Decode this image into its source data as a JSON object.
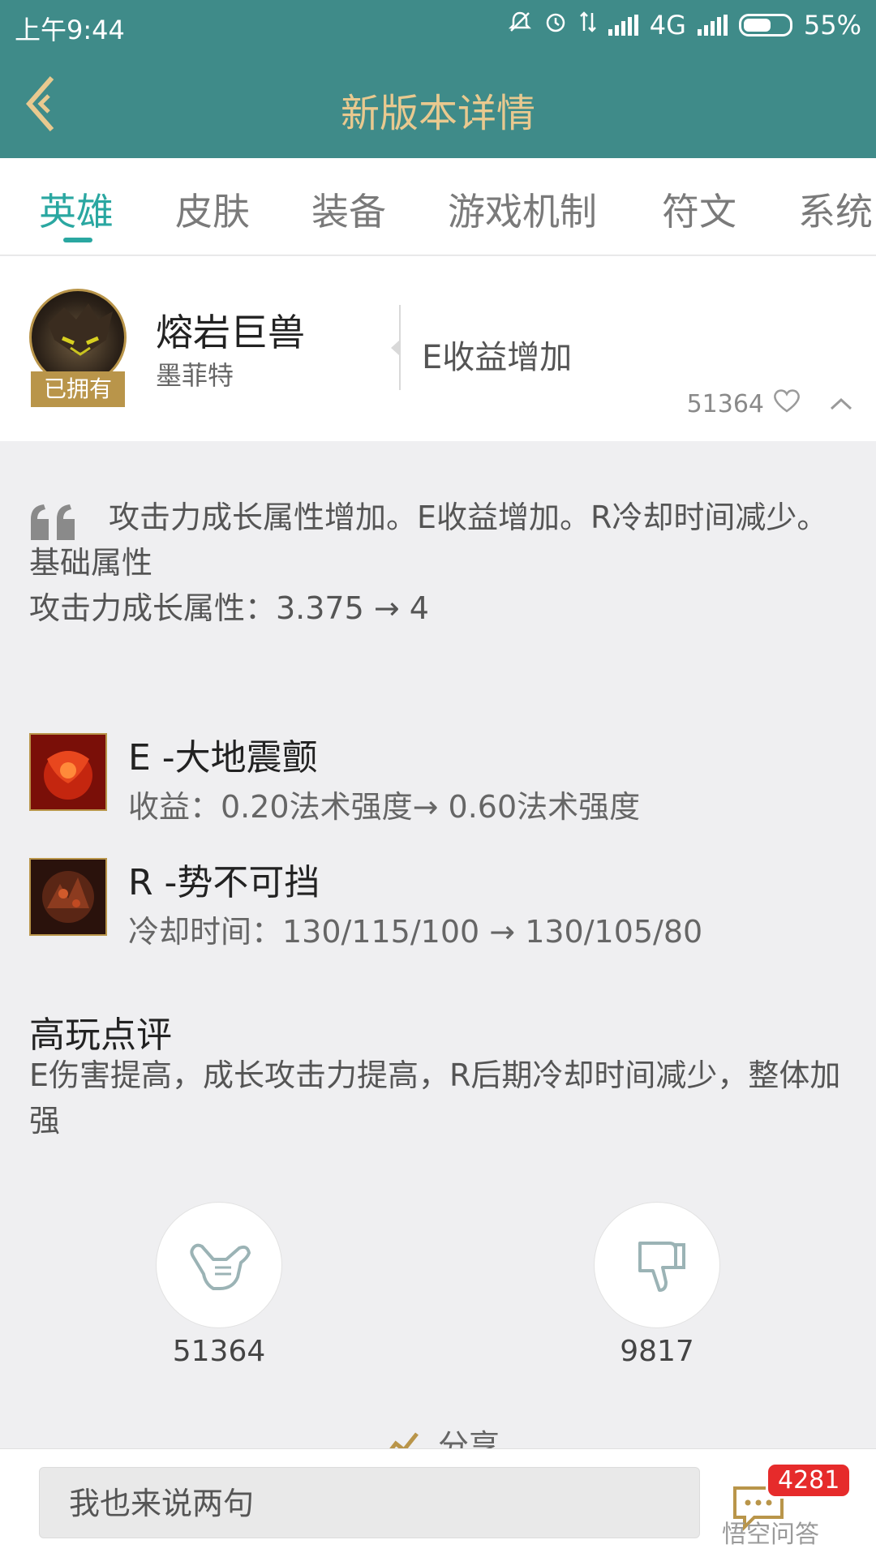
{
  "status_bar": {
    "time": "上午9:44",
    "network": "4G",
    "battery": "55%"
  },
  "header": {
    "title": "新版本详情",
    "back_icon": "chevron-left-icon"
  },
  "tabs": [
    {
      "label": "英雄",
      "active": true
    },
    {
      "label": "皮肤"
    },
    {
      "label": "装备"
    },
    {
      "label": "游戏机制"
    },
    {
      "label": "符文"
    },
    {
      "label": "系统"
    }
  ],
  "hero": {
    "name": "熔岩巨兽",
    "subname": "墨菲特",
    "owned_badge": "已拥有",
    "summary": "E收益增加",
    "likes": "51364"
  },
  "details": {
    "description": "攻击力成长属性增加。E收益增加。R冷却时间减少。",
    "section_label": "基础属性",
    "stat_change": "攻击力成长属性：3.375 → 4"
  },
  "skills": [
    {
      "title": "E -大地震颤",
      "desc": "收益：0.20法术强度→ 0.60法术强度"
    },
    {
      "title": "R -势不可挡",
      "desc": "冷却时间：130/115/100 → 130/105/80"
    }
  ],
  "review": {
    "title": "高玩点评",
    "text": "E伤害提高，成长攻击力提高，R后期冷却时间减少，整体加强"
  },
  "votes": {
    "up": "51364",
    "down": "9817"
  },
  "share": {
    "label": "分享"
  },
  "bottom": {
    "input_placeholder": "我也来说两句",
    "comment_count": "4281",
    "watermark": "悟空问答"
  },
  "colors": {
    "header_bg": "#3f8b89",
    "title_color": "#e9c98f",
    "tab_active": "#2aa7a1",
    "gold": "#b9954a",
    "badge_red": "#e62b2b"
  }
}
